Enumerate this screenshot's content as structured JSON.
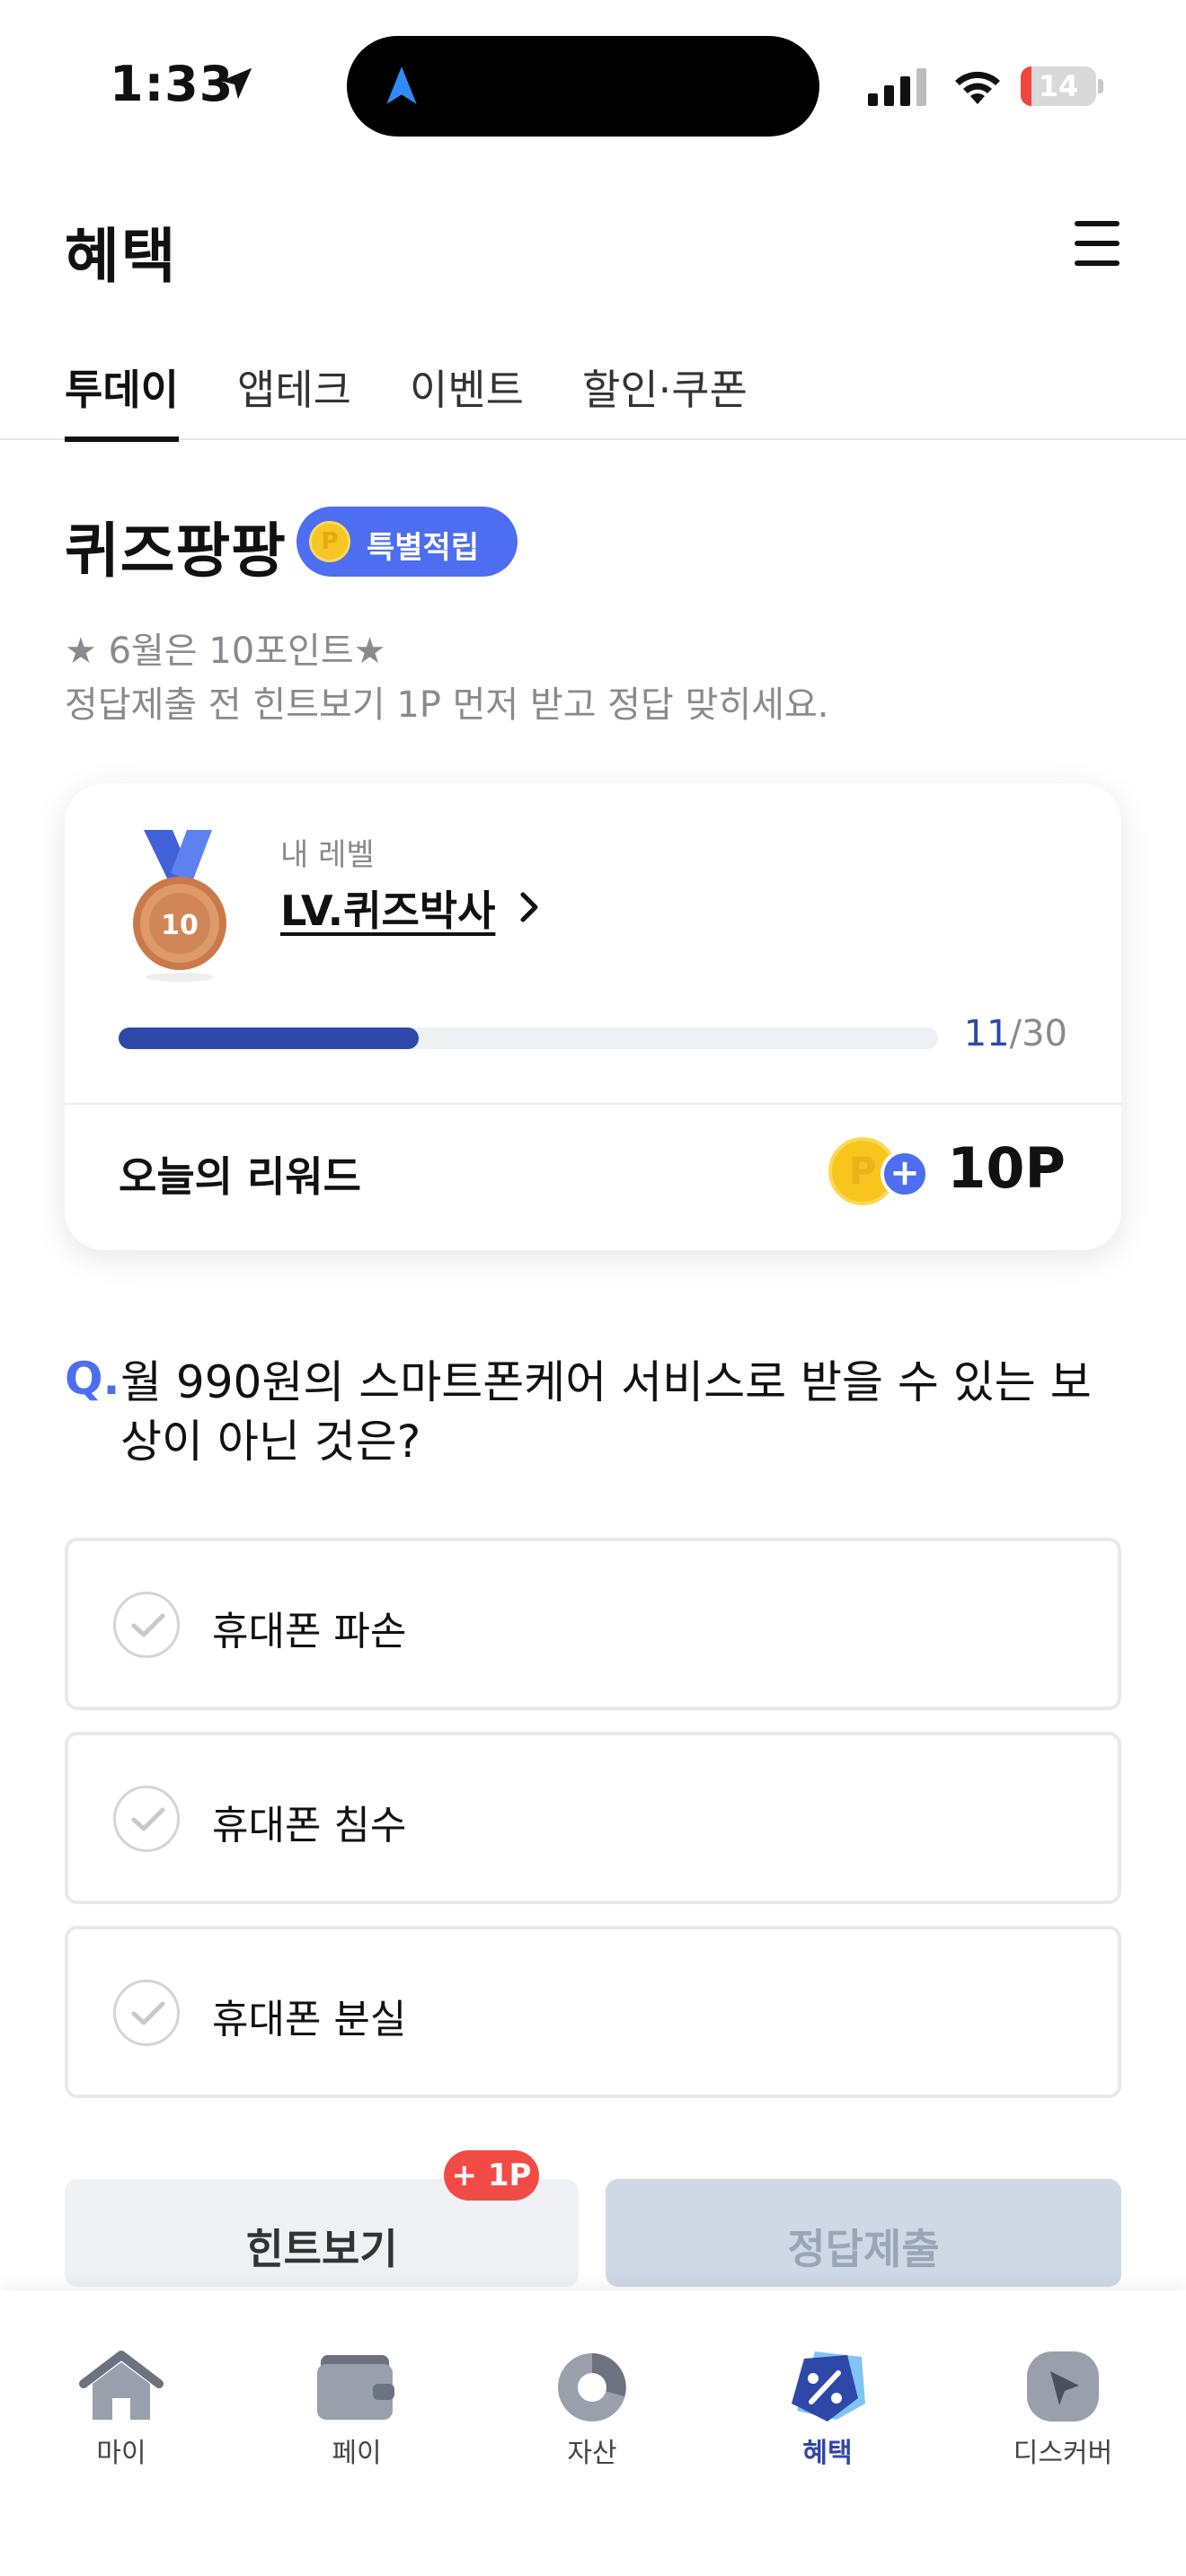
{
  "status_bar": {
    "time": "1:33",
    "battery": "14",
    "battery_level": 0.14
  },
  "header": {
    "title": "혜택"
  },
  "tabs": [
    {
      "label": "투데이",
      "active": true
    },
    {
      "label": "앱테크",
      "active": false
    },
    {
      "label": "이벤트",
      "active": false
    },
    {
      "label": "할인·쿠폰",
      "active": false
    }
  ],
  "quiz": {
    "title": "퀴즈팡팡",
    "badge": "특별적립",
    "notice_line1": "★ 6월은 10포인트★",
    "notice_line2": "정답제출 전 힌트보기 1P 먼저 받고 정답 맞히세요."
  },
  "level_card": {
    "medal_number": "10",
    "label": "내 레벨",
    "level": "LV.퀴즈박사",
    "progress_current": "11",
    "progress_total": "/30",
    "progress_fraction": 0.3667,
    "reward_label": "오늘의 리워드",
    "coin_letter": "P",
    "reward_value": "10P"
  },
  "question": {
    "prefix": "Q.",
    "text": "월 990원의 스마트폰케어 서비스로 받을 수 있는 보상이 아닌 것은?",
    "options": [
      {
        "label": "휴대폰 파손"
      },
      {
        "label": "휴대폰 침수"
      },
      {
        "label": "휴대폰 분실"
      }
    ]
  },
  "actions": {
    "hint_label": "힌트보기",
    "hint_badge": "+ 1P",
    "submit_label": "정답제출"
  },
  "bottom_nav": [
    {
      "label": "마이",
      "icon": "home-icon",
      "active": false
    },
    {
      "label": "페이",
      "icon": "wallet-icon",
      "active": false
    },
    {
      "label": "자산",
      "icon": "pie-chart-icon",
      "active": false
    },
    {
      "label": "혜택",
      "icon": "discount-tag-icon",
      "active": true
    },
    {
      "label": "디스커버",
      "icon": "compass-icon",
      "active": false
    }
  ],
  "colors": {
    "accent": "#4d6ef0",
    "progress": "#2f47a8",
    "hint_badge": "#f24b45"
  }
}
